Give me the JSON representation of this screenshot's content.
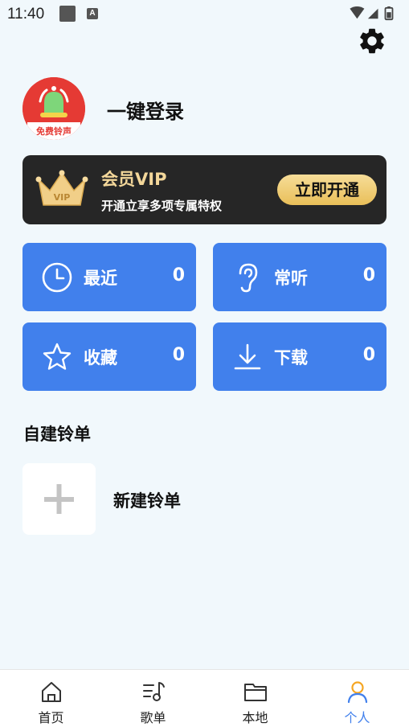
{
  "status_bar": {
    "time": "11:40",
    "a_badge": "A"
  },
  "profile": {
    "avatar_text": "免费铃声",
    "login_label": "一键登录"
  },
  "vip": {
    "title": "会员VIP",
    "subtitle": "开通立享多项专属特权",
    "button_label": "立即开通",
    "crown_text": "VIP"
  },
  "tiles": [
    {
      "label": "最近",
      "count": "0",
      "icon": "clock-icon"
    },
    {
      "label": "常听",
      "count": "0",
      "icon": "ear-icon"
    },
    {
      "label": "收藏",
      "count": "0",
      "icon": "star-icon"
    },
    {
      "label": "下载",
      "count": "0",
      "icon": "download-icon"
    }
  ],
  "playlists": {
    "section_title": "自建铃单",
    "new_label": "新建铃单"
  },
  "bottom_nav": [
    {
      "label": "首页",
      "icon": "home-icon"
    },
    {
      "label": "歌单",
      "icon": "music-list-icon"
    },
    {
      "label": "本地",
      "icon": "folder-icon"
    },
    {
      "label": "个人",
      "icon": "person-icon",
      "active": true
    }
  ],
  "colors": {
    "accent": "#4180ec",
    "background": "#f1f8fc",
    "vip_card": "#262626",
    "vip_gold": "#f3d79a",
    "avatar_red": "#e53a34"
  }
}
